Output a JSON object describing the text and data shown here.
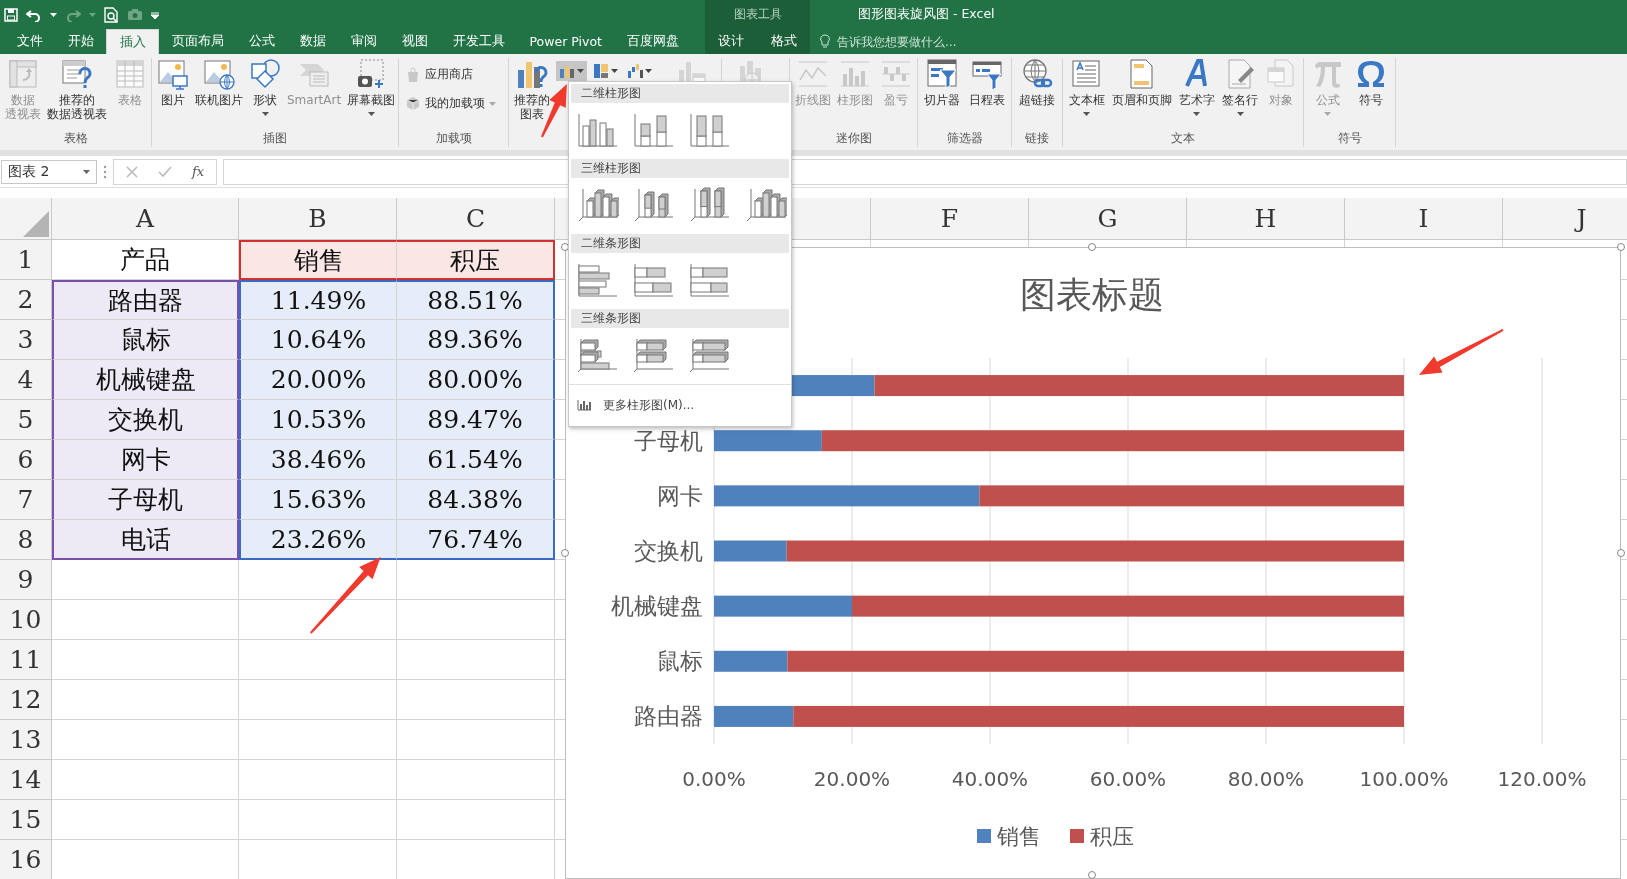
{
  "title_bar": {
    "context_group": "图表工具",
    "title": "图形图表旋风图 - Excel"
  },
  "tabs": [
    {
      "label": "文件",
      "selected": false,
      "kind": "normal"
    },
    {
      "label": "开始",
      "selected": false,
      "kind": "normal"
    },
    {
      "label": "插入",
      "selected": true,
      "kind": "normal"
    },
    {
      "label": "页面布局",
      "selected": false,
      "kind": "normal"
    },
    {
      "label": "公式",
      "selected": false,
      "kind": "normal"
    },
    {
      "label": "数据",
      "selected": false,
      "kind": "normal"
    },
    {
      "label": "审阅",
      "selected": false,
      "kind": "normal"
    },
    {
      "label": "视图",
      "selected": false,
      "kind": "normal"
    },
    {
      "label": "开发工具",
      "selected": false,
      "kind": "normal"
    },
    {
      "label": "Power Pivot",
      "selected": false,
      "kind": "normal"
    },
    {
      "label": "百度网盘",
      "selected": false,
      "kind": "normal"
    },
    {
      "label": "设计",
      "selected": false,
      "kind": "context"
    },
    {
      "label": "格式",
      "selected": false,
      "kind": "context"
    }
  ],
  "tell_me": {
    "placeholder": "告诉我您想要做什么..."
  },
  "ribbon": {
    "groups": [
      {
        "label": "表格",
        "kind": "large",
        "buttons": [
          {
            "lines": [
              "数据",
              "透视表"
            ],
            "disabled": true,
            "dropdown": false
          },
          {
            "lines": [
              "推荐的",
              "数据透视表"
            ],
            "disabled": false,
            "dropdown": false
          },
          {
            "lines": [
              "表格"
            ],
            "disabled": true,
            "dropdown": false
          }
        ]
      },
      {
        "label": "插图",
        "kind": "large",
        "buttons": [
          {
            "lines": [
              "图片"
            ],
            "disabled": false,
            "dropdown": false
          },
          {
            "lines": [
              "联机图片"
            ],
            "disabled": false,
            "dropdown": false
          },
          {
            "lines": [
              "形状"
            ],
            "disabled": false,
            "dropdown": true
          },
          {
            "lines": [
              "SmartArt"
            ],
            "disabled": true,
            "dropdown": false
          },
          {
            "lines": [
              "屏幕截图"
            ],
            "disabled": false,
            "dropdown": true
          }
        ]
      },
      {
        "label": "加载项",
        "kind": "small",
        "buttons": [
          {
            "lines": [
              "应用商店"
            ],
            "disabled": true,
            "dropdown": false
          },
          {
            "lines": [
              "我的加载项"
            ],
            "disabled": true,
            "dropdown": true
          }
        ]
      },
      {
        "kind": "chart",
        "buttons": [
          {
            "lines": [
              "推荐的",
              "图表"
            ],
            "disabled": false,
            "dropdown": false
          }
        ],
        "chart_buttons": [
          {
            "pressed": true
          },
          {
            "pressed": false
          },
          {
            "pressed": false
          }
        ]
      },
      {
        "label": "迷你图",
        "kind": "large",
        "buttons": [
          {
            "lines": [
              "折线图"
            ],
            "disabled": true,
            "dropdown": false
          },
          {
            "lines": [
              "柱形图"
            ],
            "disabled": true,
            "dropdown": false
          },
          {
            "lines": [
              "盈亏"
            ],
            "disabled": true,
            "dropdown": false
          }
        ]
      },
      {
        "label": "筛选器",
        "kind": "large",
        "buttons": [
          {
            "lines": [
              "切片器"
            ],
            "disabled": false,
            "dropdown": false
          },
          {
            "lines": [
              "日程表"
            ],
            "disabled": false,
            "dropdown": false
          }
        ]
      },
      {
        "label": "链接",
        "kind": "large",
        "buttons": [
          {
            "lines": [
              "超链接"
            ],
            "disabled": false,
            "dropdown": false
          }
        ]
      },
      {
        "label": "文本",
        "kind": "large",
        "buttons": [
          {
            "lines": [
              "文本框"
            ],
            "disabled": false,
            "dropdown": true
          },
          {
            "lines": [
              "页眉和页脚"
            ],
            "disabled": false,
            "dropdown": false
          },
          {
            "lines": [
              "艺术字"
            ],
            "disabled": false,
            "dropdown": true
          },
          {
            "lines": [
              "签名行"
            ],
            "disabled": false,
            "dropdown": true
          },
          {
            "lines": [
              "对象"
            ],
            "disabled": true,
            "dropdown": false
          }
        ]
      },
      {
        "label": "符号",
        "kind": "large",
        "buttons": [
          {
            "lines": [
              "公式"
            ],
            "disabled": true,
            "dropdown": true
          },
          {
            "lines": [
              "符号"
            ],
            "disabled": false,
            "dropdown": false
          }
        ]
      }
    ]
  },
  "formula_bar": {
    "name_box": "图表 2",
    "function_button": "fx"
  },
  "sheet": {
    "column_headers": {
      "left": [
        "A",
        "B",
        "C"
      ],
      "right": [
        "F",
        "G",
        "H",
        "I",
        "J"
      ]
    },
    "row_headers": [
      "1",
      "2",
      "3",
      "4",
      "5",
      "6",
      "7",
      "8",
      "9",
      "10",
      "11",
      "12",
      "13",
      "14",
      "15",
      "16"
    ],
    "rows": [
      [
        "产品",
        "销售",
        "积压"
      ],
      [
        "路由器",
        "11.49%",
        "88.51%"
      ],
      [
        "鼠标",
        "10.64%",
        "89.36%"
      ],
      [
        "机械键盘",
        "20.00%",
        "80.00%"
      ],
      [
        "交换机",
        "10.53%",
        "89.47%"
      ],
      [
        "网卡",
        "38.46%",
        "61.54%"
      ],
      [
        "子母机",
        "15.63%",
        "84.38%"
      ],
      [
        "电话",
        "23.26%",
        "76.74%"
      ]
    ]
  },
  "chart": {
    "selected": true,
    "chart_data": {
      "type": "bar",
      "orientation": "horizontal",
      "stacked": true,
      "title": "图表标题",
      "grid": true,
      "legend": true,
      "categories": [
        null,
        "子母机",
        "网卡",
        "交换机",
        "机械键盘",
        "鼠标",
        "路由器"
      ],
      "series": [
        {
          "name": "销售",
          "color": "#4f81bd",
          "values": [
            0.2326,
            0.1563,
            0.3846,
            0.1053,
            0.2,
            0.1064,
            0.1149
          ]
        },
        {
          "name": "积压",
          "color": "#c0504d",
          "values": [
            0.7674,
            0.8438,
            0.6154,
            0.8947,
            0.8,
            0.8936,
            0.8851
          ]
        }
      ],
      "xlim": [
        0,
        1.2
      ],
      "xticks": [
        {
          "value": 0,
          "label": "0.00%"
        },
        {
          "value": 0.2,
          "label": "20.00%"
        },
        {
          "value": 0.4,
          "label": "40.00%"
        },
        {
          "value": 0.6,
          "label": "60.00%"
        },
        {
          "value": 0.8,
          "label": "80.00%"
        },
        {
          "value": 1,
          "label": "100.00%"
        },
        {
          "value": 1.2,
          "label": "120.00%"
        }
      ]
    }
  },
  "chart_menu": {
    "sections": [
      {
        "title": "二维柱形图",
        "kind": "column2d"
      },
      {
        "title": "三维柱形图",
        "kind": "column3d"
      },
      {
        "title": "二维条形图",
        "kind": "bar2d"
      },
      {
        "title": "三维条形图",
        "kind": "bar3d"
      }
    ],
    "footer": "更多柱形图(M)..."
  }
}
